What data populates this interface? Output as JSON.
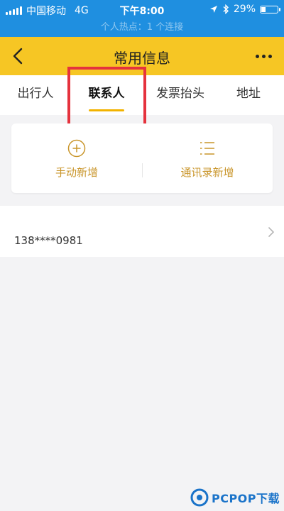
{
  "status_bar": {
    "carrier": "中国移动",
    "network": "4G",
    "time": "下午8:00",
    "battery": "29%",
    "battery_level": 0.29
  },
  "hotspot": {
    "text": "个人热点：1 个连接"
  },
  "header": {
    "title": "常用信息",
    "back_icon": "back-chevron-icon",
    "more_icon": "more-dots-icon"
  },
  "tabs": [
    {
      "label": "出行人"
    },
    {
      "label": "联系人",
      "active": true
    },
    {
      "label": "发票抬头"
    },
    {
      "label": "地址"
    }
  ],
  "actions": {
    "manual_add": {
      "label": "手动新增",
      "icon": "plus-circle-icon"
    },
    "contacts_add": {
      "label": "通讯录新增",
      "icon": "list-icon"
    }
  },
  "contact": {
    "value": "138****0981",
    "icon": "chevron-right-icon"
  },
  "watermark": {
    "text": "PCPOP下载"
  },
  "colors": {
    "status_bar": "#1f8fe0",
    "header": "#f6c624",
    "accent": "#c9952a",
    "tab_underline": "#f2b300",
    "highlight": "#e5323d"
  }
}
